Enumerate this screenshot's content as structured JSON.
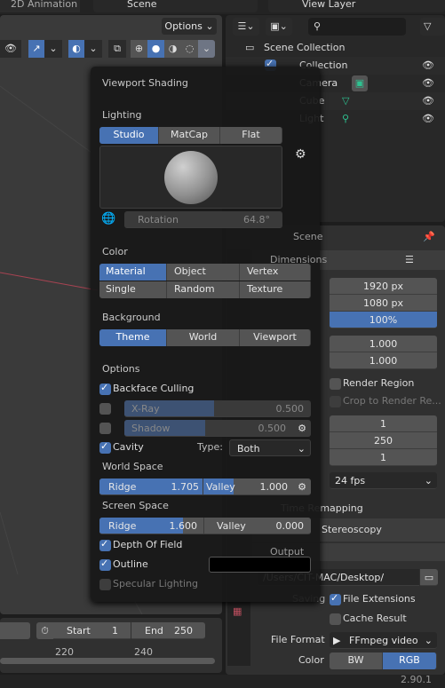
{
  "topbar": {
    "workspace_tab": "2D Animation",
    "scene": "Scene",
    "view_layer": "View Layer"
  },
  "viewport": {
    "options_label": "Options"
  },
  "outliner": {
    "items": [
      {
        "label": "Scene Collection"
      },
      {
        "label": "Collection"
      },
      {
        "label": "Camera"
      },
      {
        "label": "Cube"
      },
      {
        "label": "Light"
      }
    ]
  },
  "shading": {
    "title": "Viewport Shading",
    "lighting_label": "Lighting",
    "lighting_modes": [
      "Studio",
      "MatCap",
      "Flat"
    ],
    "rotation_label": "Rotation",
    "rotation_value": "64.8°",
    "color_label": "Color",
    "color_modes": [
      "Material",
      "Object",
      "Vertex",
      "Single",
      "Random",
      "Texture"
    ],
    "background_label": "Background",
    "background_modes": [
      "Theme",
      "World",
      "Viewport"
    ],
    "options_label": "Options",
    "backface_culling": "Backface Culling",
    "xray_label": "X-Ray",
    "xray_value": "0.500",
    "shadow_label": "Shadow",
    "shadow_value": "0.500",
    "cavity_label": "Cavity",
    "type_label": "Type:",
    "type_value": "Both",
    "world_space_label": "World Space",
    "world_ridge_label": "Ridge",
    "world_ridge_value": "1.705",
    "world_valley_label": "Valley",
    "world_valley_value": "1.000",
    "screen_space_label": "Screen Space",
    "screen_ridge_label": "Ridge",
    "screen_ridge_value": "1.600",
    "screen_valley_label": "Valley",
    "screen_valley_value": "0.000",
    "dof_label": "Depth Of Field",
    "outline_label": "Outline",
    "specular_label": "Specular Lighting",
    "outline_color": "#000000",
    "accent": "#4772b3"
  },
  "properties": {
    "scene_tab": "Scene",
    "dimensions_label": "Dimensions",
    "res_x": "1920 px",
    "res_y": "1080 px",
    "res_pct": "100%",
    "aspect_x": "1.000",
    "aspect_y": "1.000",
    "render_region": "Render Region",
    "crop": "Crop to Render Re...",
    "frame_start": "1",
    "frame_end": "250",
    "frame_step": "1",
    "frame_rate": "24 fps",
    "time_remapping": "Time Remapping",
    "stereoscopy": "Stereoscopy",
    "output_label": "Output",
    "output_path": "/Users/CIT-MAC/Desktop/",
    "saving_label": "Saving",
    "file_extensions": "File Extensions",
    "cache_result": "Cache Result",
    "file_format_label": "File Format",
    "file_format": "FFmpeg video",
    "color_label": "Color",
    "color_bw": "BW",
    "color_rgb": "RGB"
  },
  "timeline": {
    "start_label": "Start",
    "start_value": "1",
    "end_label": "End",
    "end_value": "250",
    "ticks": [
      "220",
      "240"
    ]
  },
  "statusbar": {
    "version": "2.90.1"
  }
}
